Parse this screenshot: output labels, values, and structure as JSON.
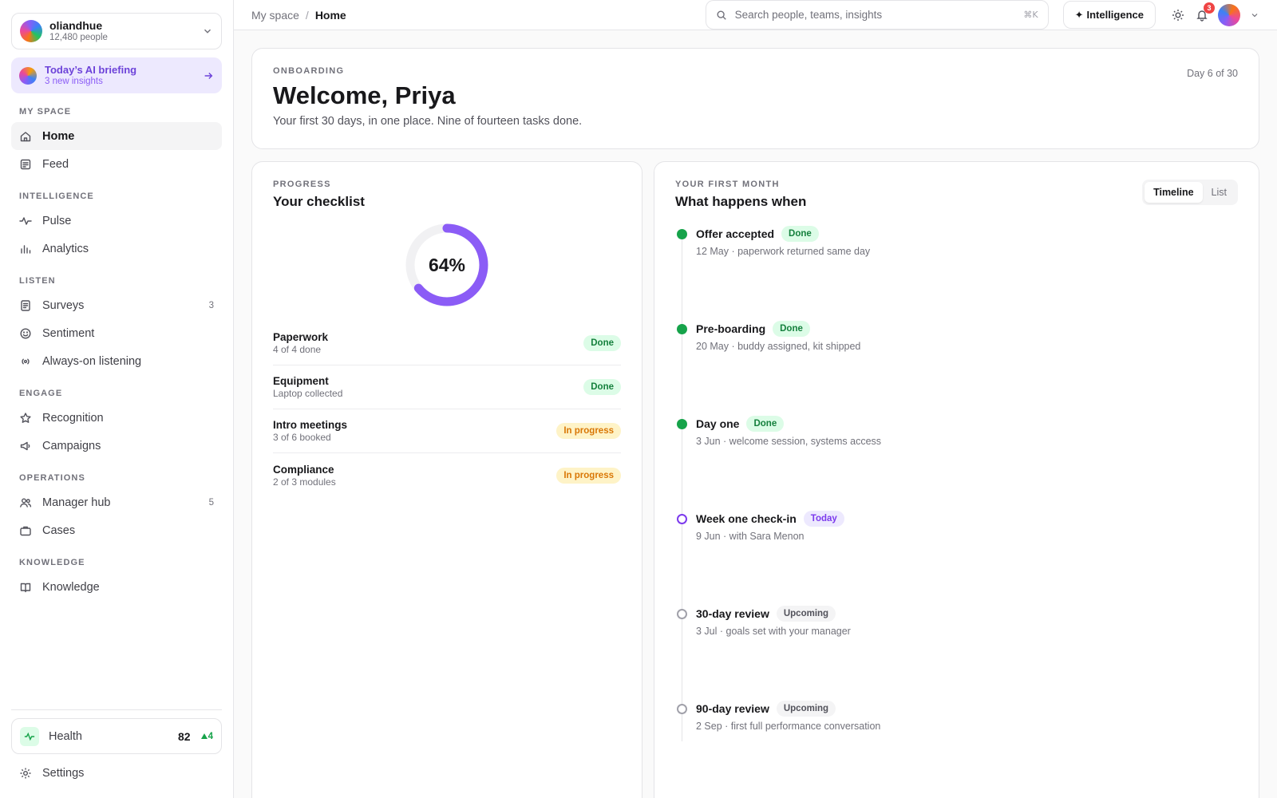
{
  "org": {
    "name": "oliandhue",
    "people": "12,480 people"
  },
  "briefing": {
    "title": "Today’s AI briefing",
    "subtitle": "3 new insights"
  },
  "sidebar": {
    "sections": [
      {
        "label": "MY SPACE",
        "items": [
          {
            "label": "Home",
            "icon": "home-icon",
            "active": true
          },
          {
            "label": "Feed",
            "icon": "feed-icon"
          }
        ]
      },
      {
        "label": "INTELLIGENCE",
        "items": [
          {
            "label": "Pulse",
            "icon": "pulse-icon"
          },
          {
            "label": "Analytics",
            "icon": "bar-chart-icon"
          }
        ]
      },
      {
        "label": "LISTEN",
        "items": [
          {
            "label": "Surveys",
            "icon": "survey-icon",
            "count": "3"
          },
          {
            "label": "Sentiment",
            "icon": "smile-icon"
          },
          {
            "label": "Always-on listening",
            "icon": "broadcast-icon"
          }
        ]
      },
      {
        "label": "ENGAGE",
        "items": [
          {
            "label": "Recognition",
            "icon": "star-icon"
          },
          {
            "label": "Campaigns",
            "icon": "megaphone-icon"
          }
        ]
      },
      {
        "label": "OPERATIONS",
        "items": [
          {
            "label": "Manager hub",
            "icon": "users-icon",
            "count": "5"
          },
          {
            "label": "Cases",
            "icon": "briefcase-icon"
          }
        ]
      },
      {
        "label": "KNOWLEDGE",
        "items": [
          {
            "label": "Knowledge",
            "icon": "book-icon"
          }
        ]
      }
    ],
    "health": {
      "label": "Health",
      "score": "82",
      "delta": "4"
    },
    "settings": "Settings"
  },
  "topbar": {
    "breadcrumb_parent": "My space",
    "breadcrumb_sep": "/",
    "breadcrumb_current": "Home",
    "search_placeholder": "Search people, teams, insights",
    "search_shortcut": "⌘K",
    "intelligence_label": "Intelligence",
    "notifications": "3"
  },
  "welcome": {
    "eyebrow": "ONBOARDING",
    "title": "Welcome, Priya",
    "subtitle": "Your first 30 days, in one place. Nine of fourteen tasks done.",
    "day": "Day 6 of 30"
  },
  "checklist": {
    "eyebrow": "PROGRESS",
    "title": "Your checklist",
    "percent_label": "64%",
    "percent": 64,
    "tasks": [
      {
        "name": "Paperwork",
        "sub": "4 of 4 done",
        "status": "Done",
        "kind": "done"
      },
      {
        "name": "Equipment",
        "sub": "Laptop collected",
        "status": "Done",
        "kind": "done"
      },
      {
        "name": "Intro meetings",
        "sub": "3 of 6 booked",
        "status": "In progress",
        "kind": "progress"
      },
      {
        "name": "Compliance",
        "sub": "2 of 3 modules",
        "status": "In progress",
        "kind": "progress"
      }
    ]
  },
  "timeline": {
    "eyebrow": "YOUR FIRST MONTH",
    "title": "What happens when",
    "toggle": [
      "Timeline",
      "List"
    ],
    "items": [
      {
        "title": "Offer accepted",
        "badge": "Done",
        "kind": "done",
        "sub": "12 May · paperwork returned same day"
      },
      {
        "title": "Pre-boarding",
        "badge": "Done",
        "kind": "done",
        "sub": "20 May · buddy assigned, kit shipped"
      },
      {
        "title": "Day one",
        "badge": "Done",
        "kind": "done",
        "sub": "3 Jun · welcome session, systems access"
      },
      {
        "title": "Week one check-in",
        "badge": "Today",
        "kind": "today",
        "sub": "9 Jun · with Sara Menon"
      },
      {
        "title": "30-day review",
        "badge": "Upcoming",
        "kind": "upcoming",
        "sub": "3 Jul · goals set with your manager"
      },
      {
        "title": "90-day review",
        "badge": "Upcoming",
        "kind": "upcoming",
        "sub": "2 Sep · first full performance conversation"
      }
    ]
  },
  "colors": {
    "accent": "#8b5cf6",
    "success": "#16a34a",
    "warning": "#d97706"
  }
}
